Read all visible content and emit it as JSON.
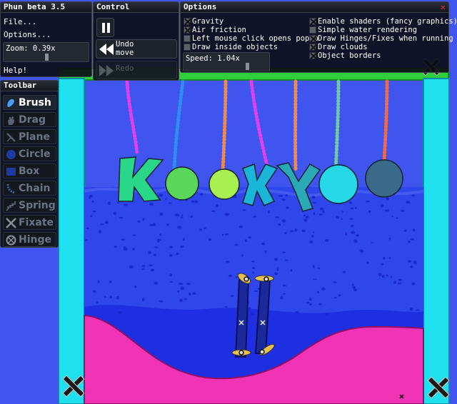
{
  "app": {
    "title": "Phun beta 3.5",
    "menu": {
      "file": "File...",
      "options": "Options...",
      "help": "Help!"
    },
    "zoom": {
      "label": "Zoom: 0.39x",
      "value": 0.39
    }
  },
  "control": {
    "title": "Control",
    "undo_line1": "Undo",
    "undo_line2": "move",
    "redo_label": "Redo"
  },
  "options": {
    "title": "Options",
    "left": [
      {
        "label": "Gravity",
        "checked": true
      },
      {
        "label": "Air friction",
        "checked": true
      },
      {
        "label": "Left mouse click opens popup",
        "checked": false
      },
      {
        "label": "Draw inside objects",
        "checked": false
      }
    ],
    "right": [
      {
        "label": "Enable shaders (fancy graphics)",
        "checked": true
      },
      {
        "label": "Simple water rendering",
        "checked": false
      },
      {
        "label": "Draw Hinges/Fixes when running",
        "checked": true
      },
      {
        "label": "Draw clouds",
        "checked": true
      },
      {
        "label": "Object borders",
        "checked": true
      }
    ],
    "speed": {
      "label": "Speed: 1.04x",
      "value": 1.04
    }
  },
  "toolbar": {
    "title": "Toolbar",
    "tools": [
      {
        "label": "Brush",
        "icon": "brush-icon",
        "active": true
      },
      {
        "label": "Drag",
        "icon": "hand-icon",
        "active": false
      },
      {
        "label": "Plane",
        "icon": "plane-icon",
        "active": false
      },
      {
        "label": "Circle",
        "icon": "circle-icon",
        "active": false
      },
      {
        "label": "Box",
        "icon": "box-icon",
        "active": false
      },
      {
        "label": "Chain",
        "icon": "chain-icon",
        "active": false
      },
      {
        "label": "Spring",
        "icon": "spring-icon",
        "active": false
      },
      {
        "label": "Fixate",
        "icon": "fixate-icon",
        "active": false
      },
      {
        "label": "Hinge",
        "icon": "hinge-icon",
        "active": false
      }
    ]
  },
  "scene_letters": [
    "K",
    "Y"
  ],
  "colors": {
    "background": "#3f55ee",
    "water": "#2e45ea",
    "pink_ground": "#f032b4",
    "cyan_walls": "#1ee0ee",
    "green_bar": "#2ecf3a"
  }
}
